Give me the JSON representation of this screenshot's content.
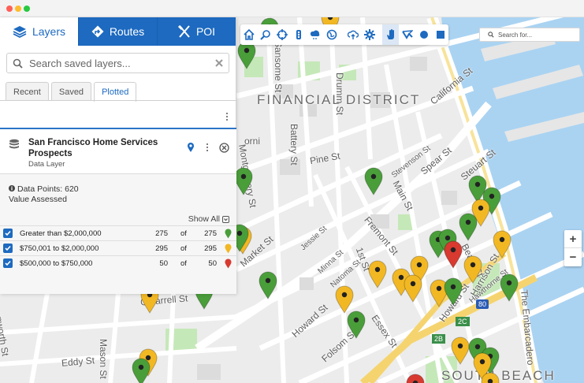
{
  "window": {
    "dot_colors": [
      "#ff5f57",
      "#febc2e",
      "#28c840"
    ]
  },
  "colors": {
    "accent": "#1d6ac0",
    "pin_green": "#4a9e3a",
    "pin_yellow": "#f2b824",
    "pin_red": "#d83a30"
  },
  "sidebar": {
    "main_tabs": [
      {
        "label": "Layers",
        "icon": "layers-icon",
        "active": true
      },
      {
        "label": "Routes",
        "icon": "directions-icon",
        "active": false
      },
      {
        "label": "POI",
        "icon": "utensils-icon",
        "active": false
      }
    ],
    "search": {
      "placeholder": "Search saved layers..."
    },
    "sub_tabs": [
      {
        "label": "Recent",
        "active": false
      },
      {
        "label": "Saved",
        "active": false
      },
      {
        "label": "Plotted",
        "active": true
      }
    ],
    "layer": {
      "title": "San Francisco Home Services Prospects",
      "subtitle": "Data Layer"
    },
    "info": {
      "data_points": "Data Points: 620",
      "value": "Value Assessed",
      "show_all": "Show All"
    },
    "legend": [
      {
        "label": "Greater than $2,000,000",
        "count": "275",
        "of": "of",
        "total": "275",
        "color": "green",
        "checked": true
      },
      {
        "label": "$750,001 to $2,000,000",
        "count": "295",
        "of": "of",
        "total": "295",
        "color": "yellow",
        "checked": true
      },
      {
        "label": "$500,000 to $750,000",
        "count": "50",
        "of": "of",
        "total": "50",
        "color": "red",
        "checked": true
      }
    ]
  },
  "map": {
    "search_placeholder": "Search for...",
    "zoom_in": "+",
    "zoom_out": "−",
    "toolbar_icons": [
      "home-icon",
      "zoom-search-icon",
      "crosshair-icon",
      "traffic-icon",
      "weather-icon",
      "globe-icon",
      "cloud-upload-icon",
      "settings-icon",
      "pan-hand-icon",
      "polyline-icon",
      "circle-draw-icon",
      "rectangle-draw-icon"
    ],
    "district_label": "FINANCIAL DISTRICT",
    "south_beach_label": "SOUTH BEACH",
    "streets": [
      "Drumm St",
      "Sansome St",
      "Battery St",
      "Montgomery St",
      "Pine St",
      "Market St",
      "Fremont St",
      "Jessie St",
      "Minna St",
      "Natoma St",
      "1st St",
      "Howard St",
      "Folsom St",
      "Essex St",
      "Harrison St",
      "Mason St",
      "Eddy St",
      "O'Farrell St",
      "The Embarcadero",
      "Howard St",
      "Spear St",
      "Steuart St",
      "Beale St",
      "Main St",
      "Stevenson St",
      "California St",
      "Hawthorne St",
      "enworth St",
      "orni"
    ],
    "highway_labels": [
      "80",
      "2C",
      "2B"
    ]
  }
}
